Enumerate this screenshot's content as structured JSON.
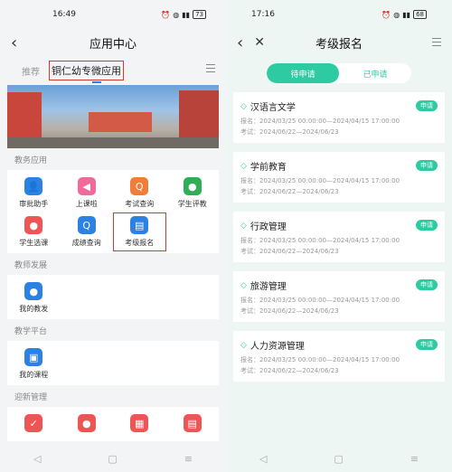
{
  "left": {
    "status": {
      "time": "16:49",
      "battery": "73"
    },
    "title": "应用中心",
    "tabs": {
      "recommend": "推荐",
      "active": "铜仁幼专微应用"
    },
    "sections": [
      {
        "title": "教务应用",
        "apps": [
          {
            "label": "审批助手",
            "icon": "user-icon",
            "color": "#2b82e4",
            "glyph": "👤"
          },
          {
            "label": "上课啦",
            "icon": "speaker-icon",
            "color": "#f06a9b",
            "glyph": "◀"
          },
          {
            "label": "考试查询",
            "icon": "search-doc-icon",
            "color": "#f27d3a",
            "glyph": "Q"
          },
          {
            "label": "学生评教",
            "icon": "person-icon",
            "color": "#2fae57",
            "glyph": "●"
          },
          {
            "label": "学生选课",
            "icon": "person-icon",
            "color": "#ee5655",
            "glyph": "●"
          },
          {
            "label": "成绩查询",
            "icon": "search-icon",
            "color": "#2b82e4",
            "glyph": "Q"
          },
          {
            "label": "考级报名",
            "icon": "doc-icon",
            "color": "#2b82e4",
            "glyph": "▤"
          }
        ]
      },
      {
        "title": "教师发展",
        "apps": [
          {
            "label": "我的教发",
            "icon": "person-icon",
            "color": "#2b82e4",
            "glyph": "●"
          }
        ]
      },
      {
        "title": "教学平台",
        "apps": [
          {
            "label": "我的课程",
            "icon": "book-icon",
            "color": "#2b82e4",
            "glyph": "▣"
          }
        ]
      },
      {
        "title": "迎新管理",
        "apps": [
          {
            "label": "",
            "icon": "check-icon",
            "color": "#ee5655",
            "glyph": "✓"
          },
          {
            "label": "",
            "icon": "bag-icon",
            "color": "#ee5655",
            "glyph": "●"
          },
          {
            "label": "",
            "icon": "building-icon",
            "color": "#ee5655",
            "glyph": "▦"
          },
          {
            "label": "",
            "icon": "calendar-icon",
            "color": "#ee5655",
            "glyph": "▤"
          }
        ]
      }
    ]
  },
  "right": {
    "status": {
      "time": "17:16",
      "battery": "68"
    },
    "title": "考级报名",
    "seg": {
      "pending": "待申请",
      "applied": "已申请"
    },
    "badge": "申请",
    "cards": [
      {
        "name": "汉语言文学",
        "reg": "报名：2024/03/25 00:00:00—2024/04/15 17:00:00",
        "exam": "考试：2024/06/22—2024/06/23"
      },
      {
        "name": "学前教育",
        "reg": "报名：2024/03/25 00:00:00—2024/04/15 17:00:00",
        "exam": "考试：2024/06/22—2024/06/23"
      },
      {
        "name": "行政管理",
        "reg": "报名：2024/03/25 00:00:00—2024/04/15 17:00:00",
        "exam": "考试：2024/06/22—2024/06/23"
      },
      {
        "name": "旅游管理",
        "reg": "报名：2024/03/25 00:00:00—2024/04/15 17:00:00",
        "exam": "考试：2024/06/22—2024/06/23"
      },
      {
        "name": "人力资源管理",
        "reg": "报名：2024/03/25 00:00:00—2024/04/15 17:00:00",
        "exam": "考试：2024/06/22—2024/06/23"
      }
    ]
  }
}
